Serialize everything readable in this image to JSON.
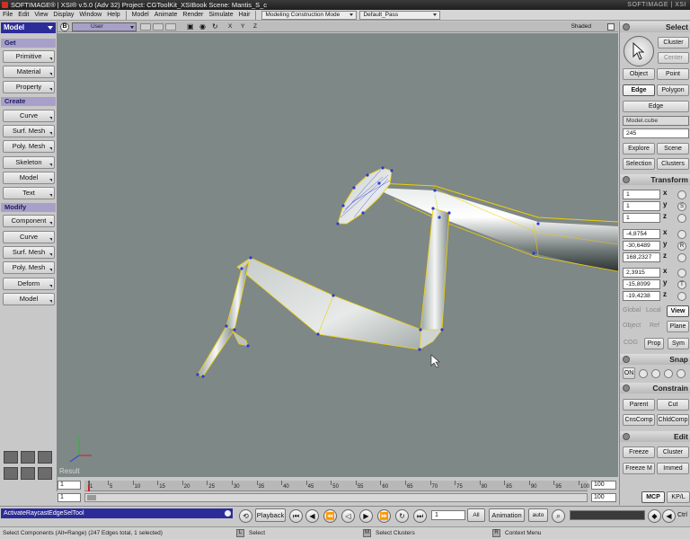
{
  "title_bar": {
    "text": "SOFTIMAGE® | XSI® v.5.0 (Adv 32) Project: CGToolKit_XSIBook   Scene: Mantis_S_c",
    "brand": "SOFTIMAGE | XSI"
  },
  "menu_bar": {
    "items": [
      "File",
      "Edit",
      "View",
      "Display",
      "Window",
      "Help"
    ],
    "modules": [
      "Model",
      "Animate",
      "Render",
      "Simulate",
      "Hair"
    ],
    "construction_mode": "Modeling Construction Mode",
    "render_pass": "Default_Pass"
  },
  "left_panel": {
    "mode": "Model",
    "sections": {
      "get": {
        "label": "Get",
        "buttons": [
          "Primitive",
          "Material",
          "Property"
        ]
      },
      "create": {
        "label": "Create",
        "buttons": [
          "Curve",
          "Surf. Mesh",
          "Poly. Mesh",
          "Skeleton",
          "Model",
          "Text"
        ]
      },
      "modify": {
        "label": "Modify",
        "buttons": [
          "Component",
          "Curve",
          "Surf. Mesh",
          "Poly. Mesh",
          "Deform",
          "Model"
        ]
      }
    }
  },
  "viewport": {
    "letter": "B",
    "camera": "User",
    "axes": "X Y Z",
    "display_mode": "Shaded",
    "overlay_label": "Result"
  },
  "timeline": {
    "start": "1",
    "current": "1",
    "end": "100",
    "end_field": "100",
    "ruler_labels": [
      "1",
      "5",
      "10",
      "15",
      "20",
      "25",
      "30",
      "35",
      "40",
      "45",
      "50",
      "55",
      "60",
      "65",
      "70",
      "75",
      "80",
      "85",
      "90",
      "95",
      "100"
    ]
  },
  "bottom_bar": {
    "command": "ActivateRaycastEdgeSelTool",
    "playback_label": "Playback",
    "frame_field": "1",
    "frame_mode": "All",
    "animation_label": "Animation",
    "auto_label": "auto",
    "ctrl_label": "Ctrl"
  },
  "status_bar": {
    "message": "Select Components (Alt=Range) (247 Edges total, 1 selected)",
    "left_key": "L",
    "left_action": "Select",
    "middle_key": "M",
    "middle_action": "Select Clusters",
    "right_key": "R",
    "right_action": "Context Menu"
  },
  "right_panel": {
    "select": {
      "header": "Select",
      "cluster": "Cluster",
      "center": "Center",
      "object": "Object",
      "point": "Point",
      "edge": "Edge",
      "polygon": "Polygon",
      "filter": "Edge",
      "selection_name": "Model.cube",
      "selection_value": "245",
      "explore": "Explore",
      "scene": "Scene",
      "selection": "Selection",
      "clusters": "Clusters"
    },
    "transform": {
      "header": "Transform",
      "scale": {
        "x": "1",
        "y": "1",
        "z": "1"
      },
      "rotation": {
        "x": "-4,8754",
        "y": "-30,6489",
        "z": "168,2327"
      },
      "translation": {
        "x": "2,3915",
        "y": "-15,8099",
        "z": "-19,4238"
      },
      "global": "Global",
      "local": "Local",
      "view": "View",
      "object": "Object",
      "ref": "Ref",
      "plane": "Plane",
      "cog": "COG",
      "prop": "Prop",
      "sym": "Sym",
      "s_label": "S",
      "r_label": "R",
      "t_label": "T"
    },
    "snap": {
      "header": "Snap",
      "on": "ON"
    },
    "constrain": {
      "header": "Constrain",
      "parent": "Parent",
      "cut": "Cut",
      "cnscomp": "CnsComp",
      "chldcomp": "ChldComp"
    },
    "edit": {
      "header": "Edit",
      "freeze": "Freeze",
      "cluster": "Cluster",
      "freeze_m": "Freeze M",
      "immed": "Immed"
    },
    "bottom_tabs": [
      "MCP",
      "KP/L"
    ]
  },
  "colors": {
    "viewport_bg": "#7e8886",
    "selection_highlight": "#f0d000",
    "vertex": "#2a3ad8",
    "panel_bg": "#c8c8c8",
    "command_bg": "#2c2c98"
  }
}
